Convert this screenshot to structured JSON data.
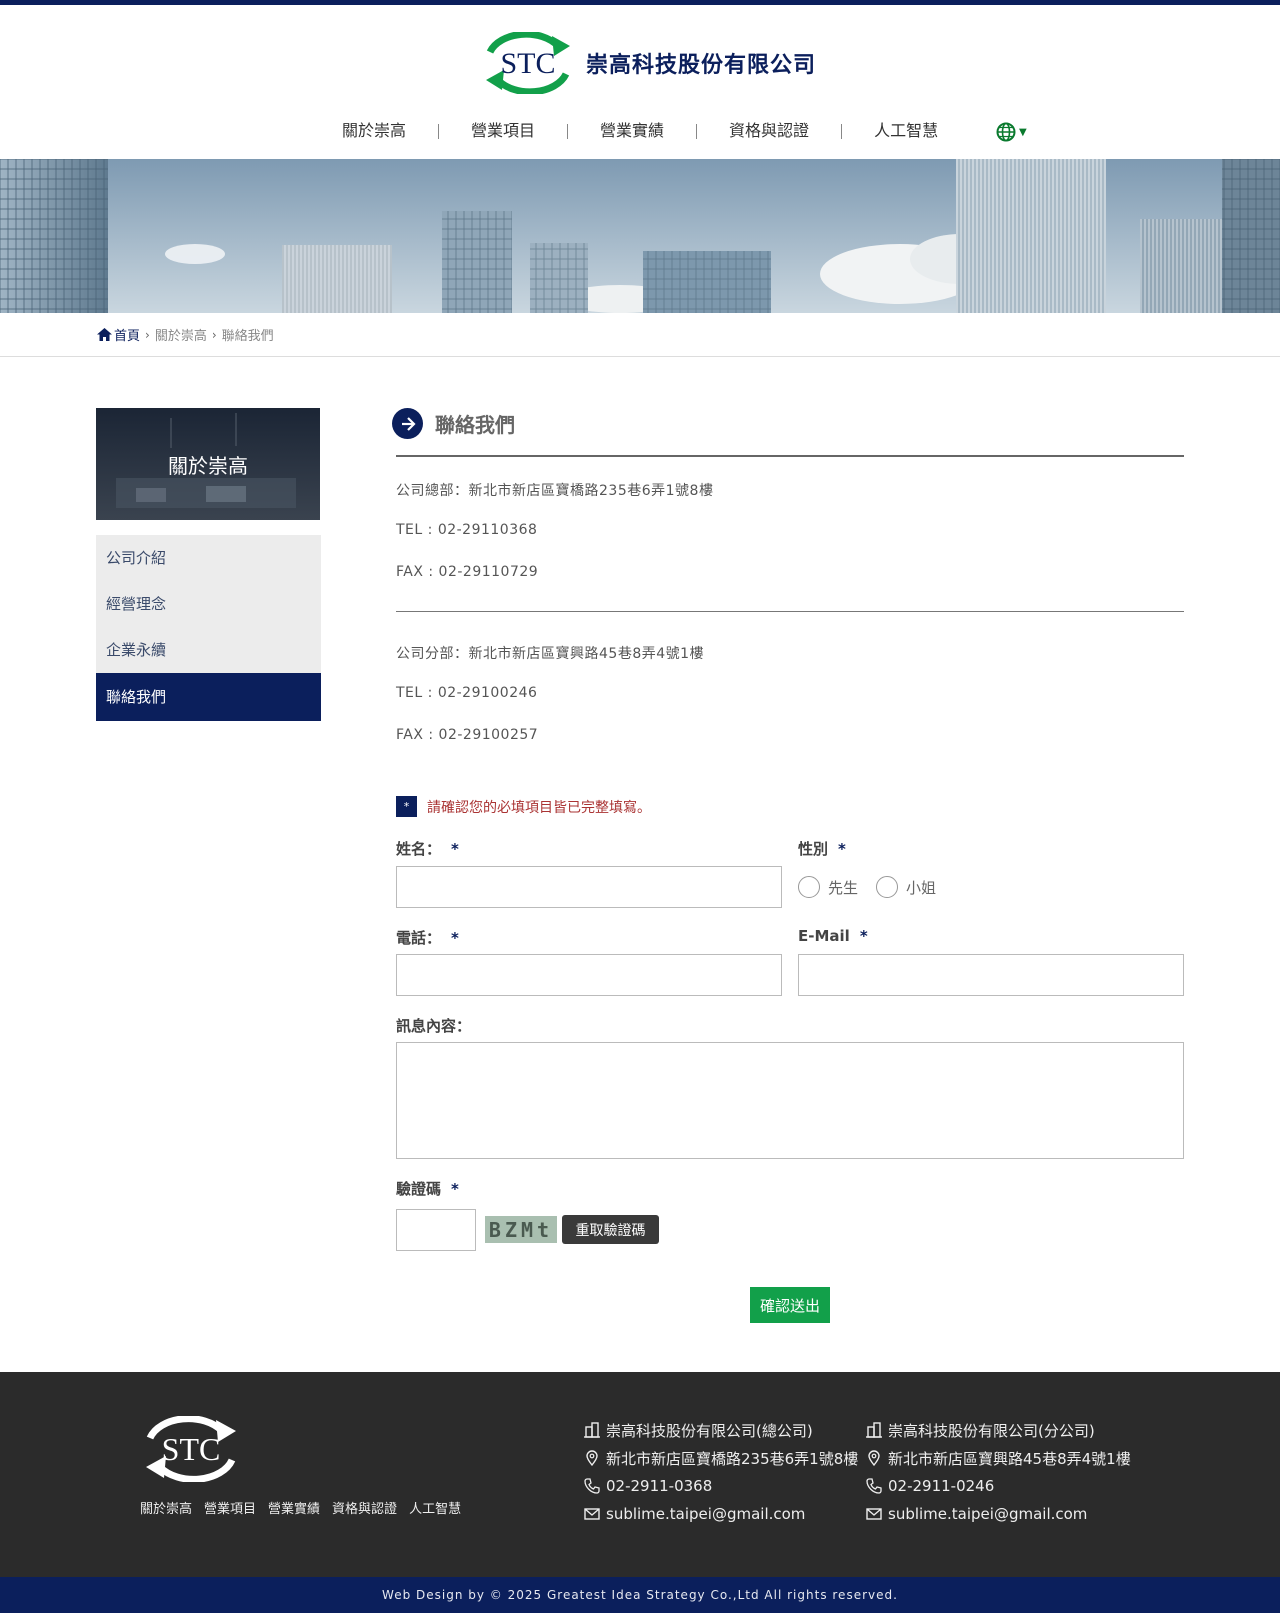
{
  "header": {
    "logo_text": "STC",
    "company_name": "崇高科技股份有限公司",
    "nav": [
      "關於崇高",
      "營業項目",
      "營業實績",
      "資格與認證",
      "人工智慧"
    ],
    "language_icon": "globe-icon"
  },
  "breadcrumb": {
    "home": "首頁",
    "items": [
      "關於崇高",
      "聯絡我們"
    ]
  },
  "sidebar": {
    "title": "關於崇高",
    "items": [
      "公司介紹",
      "經營理念",
      "企業永續",
      "聯絡我們"
    ],
    "active_index": 3
  },
  "main": {
    "title": "聯絡我們",
    "hq": {
      "address": "公司總部：新北市新店區寶橋路235巷6弄1號8樓",
      "tel": "TEL : 02-29110368",
      "fax": "FAX : 02-29110729"
    },
    "branch": {
      "address": "公司分部：新北市新店區寶興路45巷8弄4號1樓",
      "tel": "TEL : 02-29100246",
      "fax": "FAX : 02-29100257"
    }
  },
  "form": {
    "notice_star": "*",
    "notice": "請確認您的必填項目皆已完整填寫。",
    "required_mark": "*",
    "name_label": "姓名：",
    "gender_label": "性別",
    "gender_options": [
      "先生",
      "小姐"
    ],
    "phone_label": "電話：",
    "email_label": "E-Mail",
    "message_label": "訊息內容：",
    "captcha_label": "驗證碼",
    "captcha_text": "BZMt",
    "refresh_label": "重取驗證碼",
    "submit_label": "確認送出",
    "values": {
      "name": "",
      "phone": "",
      "email": "",
      "message": "",
      "captcha": ""
    }
  },
  "footer": {
    "logo_text": "STC",
    "links": [
      "關於崇高",
      "營業項目",
      "營業實績",
      "資格與認證",
      "人工智慧"
    ],
    "hq": {
      "name": "崇高科技股份有限公司(總公司)",
      "address": "新北市新店區寶橋路235巷6弄1號8樓",
      "phone": "02-2911-0368",
      "email": "sublime.taipei@gmail.com"
    },
    "branch": {
      "name": "崇高科技股份有限公司(分公司)",
      "address": "新北市新店區寶興路45巷8弄4號1樓",
      "phone": "02-2911-0246",
      "email": "sublime.taipei@gmail.com"
    },
    "copyright": "Web Design by © 2025 Greatest Idea Strategy Co.,Ltd All rights reserved."
  },
  "colors": {
    "navy": "#0b1f5c",
    "green": "#12a04a",
    "footer_bg": "#2b2b2b",
    "notice_red": "#a33"
  }
}
